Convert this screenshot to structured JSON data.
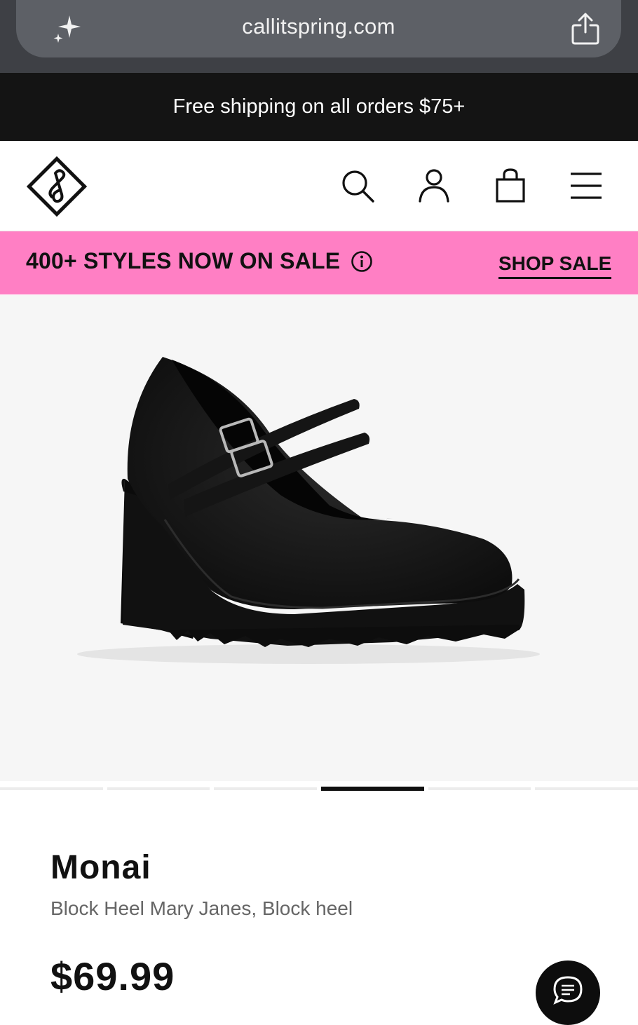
{
  "browser": {
    "url": "callitspring.com"
  },
  "promo": {
    "text": "Free shipping on all orders $75+"
  },
  "header": {
    "icons": [
      "search-icon",
      "account-icon",
      "bag-icon",
      "menu-icon"
    ]
  },
  "sale_banner": {
    "text": "400+ STYLES NOW ON SALE",
    "cta": "SHOP SALE",
    "color": "#ff7fc4"
  },
  "carousel": {
    "total": 6,
    "active": 4
  },
  "product": {
    "name": "Monai",
    "subtitle": "Block Heel Mary Janes, Block heel",
    "price": "$69.99"
  }
}
